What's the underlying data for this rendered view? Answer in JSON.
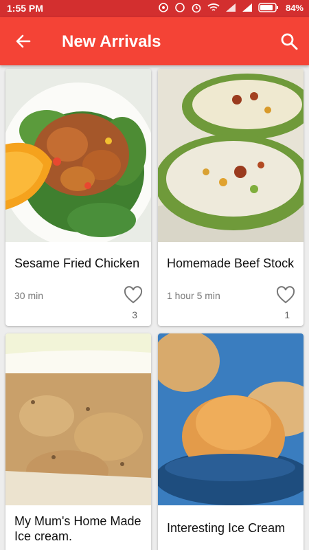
{
  "status_bar": {
    "time": "1:55 PM",
    "battery": "84%"
  },
  "app_bar": {
    "title": "New Arrivals"
  },
  "icons": {
    "back": "arrow-back-icon",
    "search": "search-icon",
    "like": "heart-outline-icon"
  },
  "colors": {
    "app_bar": "#f44336",
    "status_bar": "#d32f2f"
  },
  "recipes": [
    {
      "title": "Sesame Fried Chicken",
      "time": "30 min",
      "likes": "3"
    },
    {
      "title": "Homemade Beef Stock",
      "time": "1 hour 5 min",
      "likes": "1"
    },
    {
      "title": "My Mum's Home Made Ice cream."
    },
    {
      "title": "Interesting Ice Cream"
    }
  ]
}
